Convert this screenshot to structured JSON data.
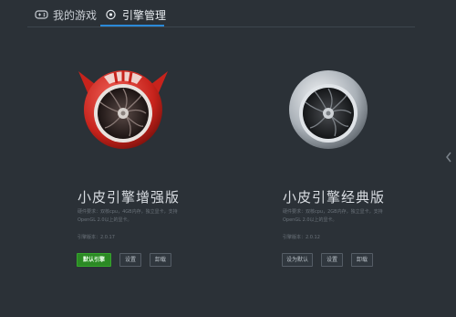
{
  "tabs": [
    {
      "label": "我的游戏",
      "icon": "gamepad-icon"
    },
    {
      "label": "引擎管理",
      "icon": "engine-icon"
    }
  ],
  "engines": [
    {
      "title": "小皮引擎增强版",
      "desc": "硬件要求：双核cpu，4GB内存，独立显卡，支持OpenGL 2.0以上的显卡。",
      "version": "引擎版本：2.0.17",
      "buttons": [
        "默认引擎",
        "设置",
        "卸载"
      ],
      "accent": "#d9322a"
    },
    {
      "title": "小皮引擎经典版",
      "desc": "硬件要求：双核cpu，2GB内存，独立显卡，支持OpenGL 2.0以上的显卡。",
      "version": "引擎版本：2.0.12",
      "buttons": [
        "设为默认",
        "设置",
        "卸载"
      ],
      "accent": "#b8bec5"
    }
  ],
  "colors": {
    "tab_active": "#2a89d8",
    "default_button": "#2b8a24"
  }
}
